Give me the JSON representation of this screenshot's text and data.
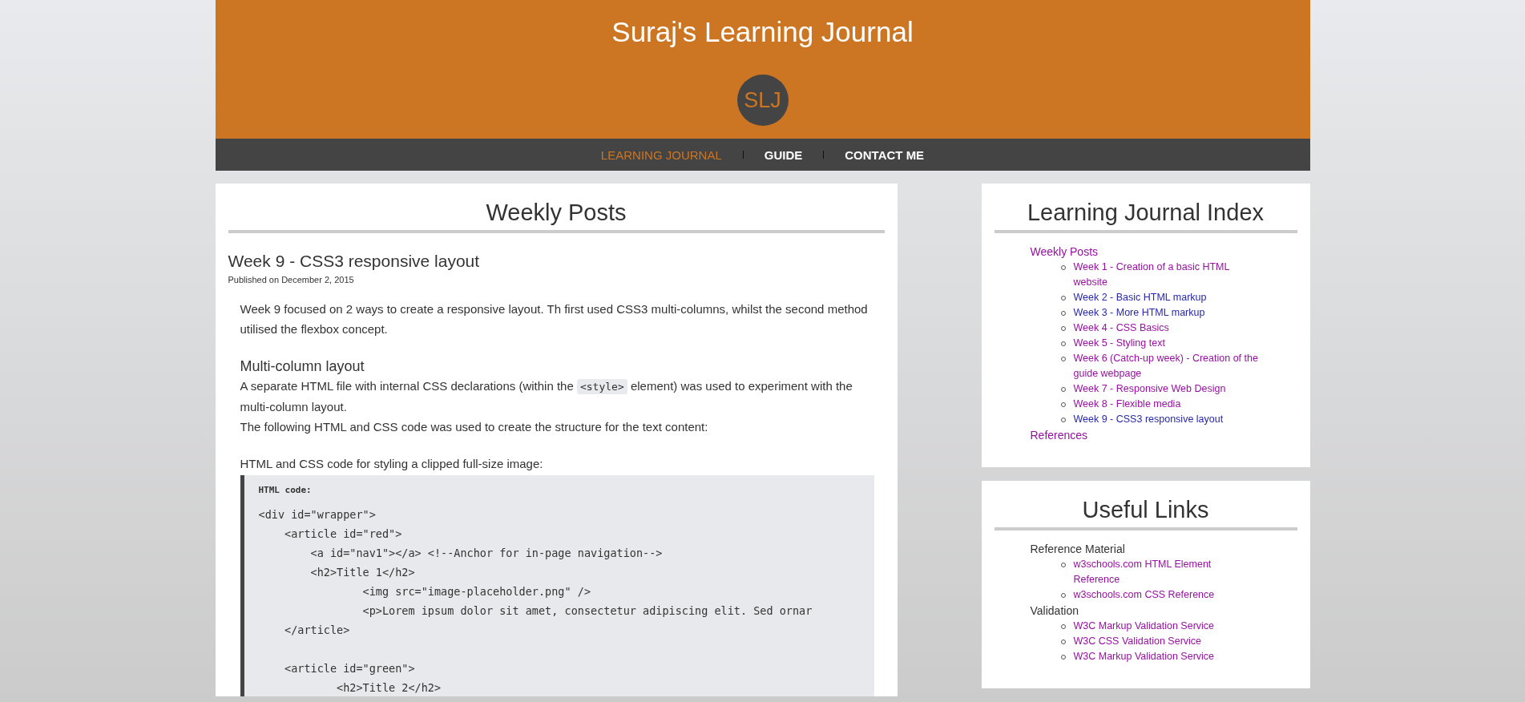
{
  "header": {
    "title": "Suraj's Learning Journal",
    "logo_text": "SLJ"
  },
  "nav": [
    {
      "label": "LEARNING JOURNAL",
      "selected": true
    },
    {
      "label": "GUIDE",
      "selected": false
    },
    {
      "label": "CONTACT ME",
      "selected": false
    }
  ],
  "main": {
    "heading": "Weekly Posts",
    "post": {
      "title": "Week 9 - CSS3 responsive layout",
      "date": "Published on December 2, 2015",
      "blocks": [
        {
          "kind": "paragraph",
          "parts": [
            {
              "kind": "text",
              "text": "Week 9 focused on 2 ways to create a responsive layout. Th first used CSS3 multi-columns, whilst the second method utilised the flexbox concept."
            }
          ]
        },
        {
          "kind": "subheading",
          "text": "Multi-column layout"
        },
        {
          "kind": "paragraph",
          "parts": [
            {
              "kind": "text",
              "text": "A separate HTML file with internal CSS declarations (within the "
            },
            {
              "kind": "code",
              "text": "<style>"
            },
            {
              "kind": "text",
              "text": " element) was used to experiment with the multi-column layout."
            }
          ]
        },
        {
          "kind": "paragraph",
          "parts": [
            {
              "kind": "text",
              "text": "The following HTML and CSS code was used to create the structure for the text content:"
            }
          ]
        },
        {
          "kind": "caption",
          "text": "HTML and CSS code for styling a clipped full-size image:"
        },
        {
          "kind": "code",
          "label": "HTML code:",
          "chunks": [
            [
              "<div id=\"wrapper\">",
              "    <article id=\"red\">",
              "        <a id=\"nav1\"></a> <!--Anchor for in-page navigation-->",
              "        <h2>Title 1</h2>",
              "                <img src=\"image-placeholder.png\" />",
              "                <p>Lorem ipsum dolor sit amet, consectetur adipiscing elit. Sed ornar",
              "    </article>"
            ],
            [
              "    <article id=\"green\">",
              "            <h2>Title 2</h2>"
            ]
          ]
        }
      ]
    }
  },
  "sidebar": [
    {
      "heading": "Learning Journal Index",
      "groups": [
        {
          "label": "Weekly Posts",
          "kind": "link",
          "visited": true,
          "items": [
            {
              "label": "Week 1 - Creation of a basic HTML website",
              "visited": true
            },
            {
              "label": "Week 2 - Basic HTML markup",
              "visited": false
            },
            {
              "label": "Week 3 - More HTML markup",
              "visited": false
            },
            {
              "label": "Week 4 - CSS Basics",
              "visited": true
            },
            {
              "label": "Week 5 - Styling text",
              "visited": true
            },
            {
              "label": "Week 6 (Catch-up week) - Creation of the guide webpage",
              "visited": true
            },
            {
              "label": "Week 7 - Responsive Web Design",
              "visited": true
            },
            {
              "label": "Week 8 - Flexible media",
              "visited": true
            },
            {
              "label": "Week 9 - CSS3 responsive layout",
              "visited": false
            }
          ]
        },
        {
          "label": "References",
          "kind": "link",
          "visited": true
        }
      ]
    },
    {
      "heading": "Useful Links",
      "groups": [
        {
          "label": "Reference Material",
          "kind": "text",
          "items": [
            {
              "label": "w3schools.com HTML Element Reference",
              "visited": true
            },
            {
              "label": "w3schools.com CSS Reference",
              "visited": true
            }
          ]
        },
        {
          "label": "Validation",
          "kind": "text",
          "items": [
            {
              "label": "W3C Markup Validation Service",
              "visited": true
            },
            {
              "label": "W3C CSS Validation Service",
              "visited": true
            },
            {
              "label": "W3C Markup Validation Service",
              "visited": true
            }
          ]
        }
      ]
    }
  ]
}
